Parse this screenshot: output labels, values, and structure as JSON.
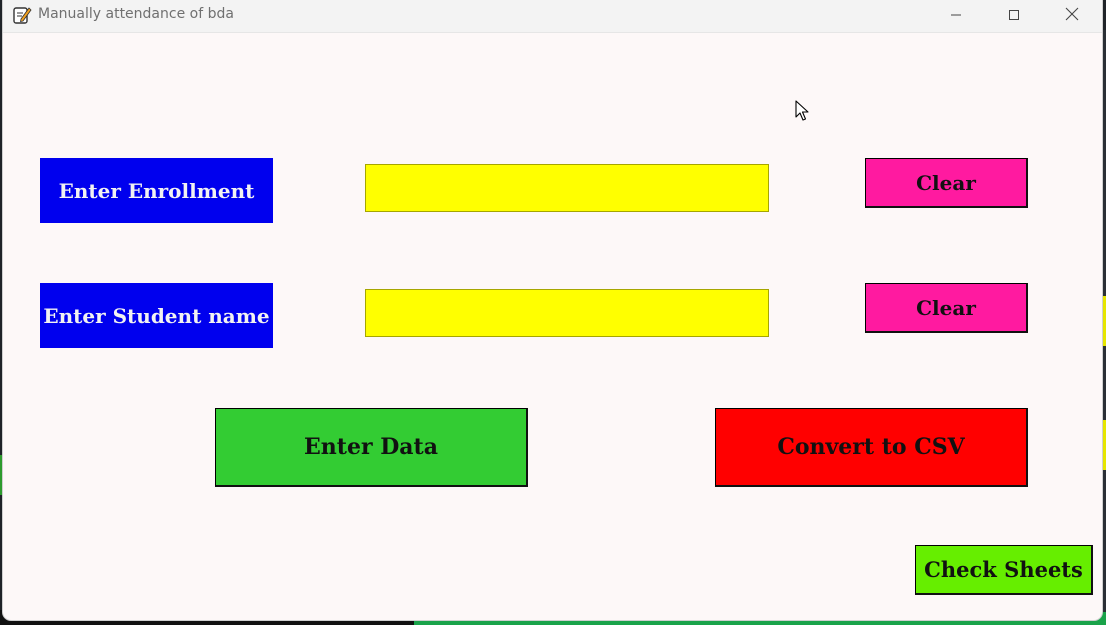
{
  "window": {
    "title": "Manually attendance of bda",
    "controls": {
      "minimize_icon": "minimize-icon",
      "maximize_icon": "maximize-icon",
      "close_icon": "close-icon"
    }
  },
  "form": {
    "enrollment": {
      "label": "Enter Enrollment",
      "value": "",
      "clear_label": "Clear"
    },
    "student_name": {
      "label": "Enter Student name",
      "value": "",
      "clear_label": "Clear"
    }
  },
  "actions": {
    "enter_data_label": "Enter Data",
    "convert_csv_label": "Convert to CSV",
    "check_sheets_label": "Check Sheets"
  },
  "colors": {
    "label_bg": "#0000ee",
    "input_bg": "#ffff00",
    "clear_bg": "#ff1aa0",
    "enter_bg": "#33cc33",
    "csv_bg": "#ff0000",
    "sheets_bg": "#66ee00",
    "window_bg": "#fdf8f8"
  }
}
